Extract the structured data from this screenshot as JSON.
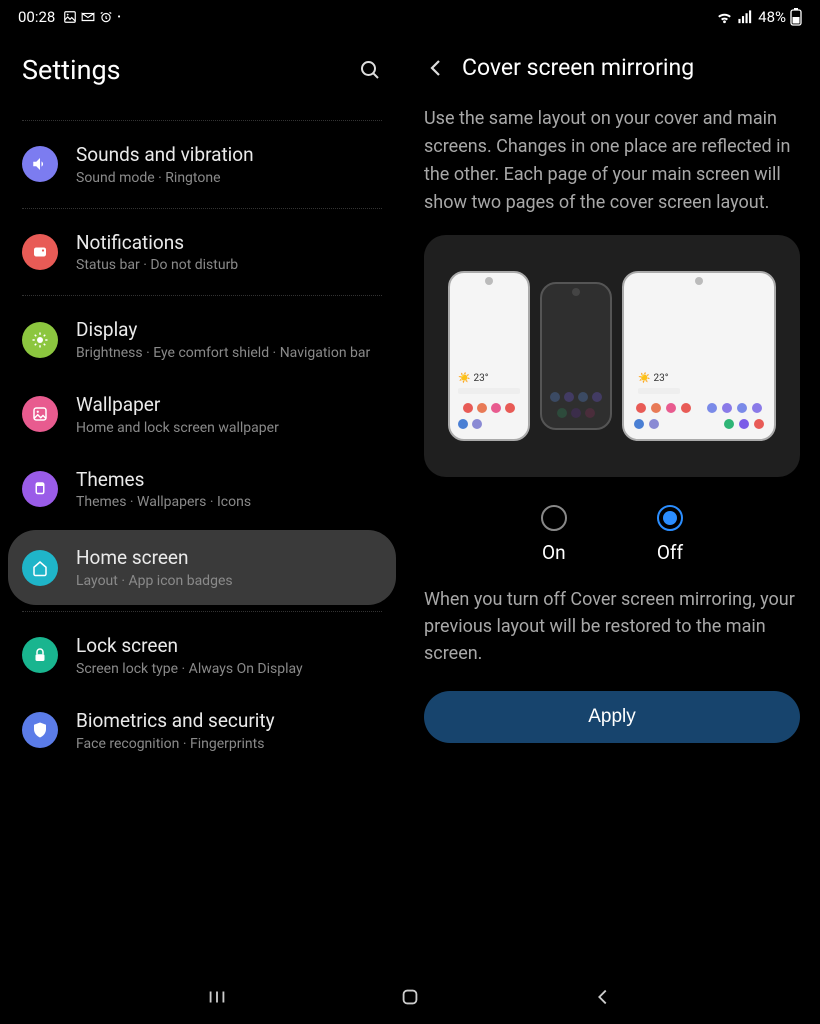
{
  "statusbar": {
    "time": "00:28",
    "battery": "48%"
  },
  "left": {
    "title": "Settings",
    "items": [
      {
        "title": "Sounds and vibration",
        "sub": "Sound mode · Ringtone",
        "color": "#7c7cf0",
        "icon": "sound"
      },
      {
        "title": "Notifications",
        "sub": "Status bar · Do not disturb",
        "color": "#e85b56",
        "icon": "notif"
      },
      {
        "title": "Display",
        "sub": "Brightness · Eye comfort shield · Navigation bar",
        "color": "#8cc63f",
        "icon": "display"
      },
      {
        "title": "Wallpaper",
        "sub": "Home and lock screen wallpaper",
        "color": "#e85b8f",
        "icon": "wallpaper"
      },
      {
        "title": "Themes",
        "sub": "Themes · Wallpapers · Icons",
        "color": "#9a5ce8",
        "icon": "themes"
      },
      {
        "title": "Home screen",
        "sub": "Layout · App icon badges",
        "color": "#1fb5c9",
        "icon": "home"
      },
      {
        "title": "Lock screen",
        "sub": "Screen lock type · Always On Display",
        "color": "#19b58f",
        "icon": "lock"
      },
      {
        "title": "Biometrics and security",
        "sub": "Face recognition · Fingerprints",
        "color": "#5b7ce8",
        "icon": "shield"
      }
    ],
    "selected_index": 5,
    "dividers_after": [
      1,
      2,
      6
    ]
  },
  "right": {
    "title": "Cover screen mirroring",
    "description": "Use the same layout on your cover and main screens. Changes in one place are reflected in the other. Each page of your main screen will show two pages of the cover screen layout.",
    "weather_temp": "23°",
    "options": [
      {
        "label": "On",
        "checked": false
      },
      {
        "label": "Off",
        "checked": true
      }
    ],
    "off_description": "When you turn off Cover screen mirroring, your previous layout will be restored to the main screen.",
    "apply_label": "Apply"
  }
}
